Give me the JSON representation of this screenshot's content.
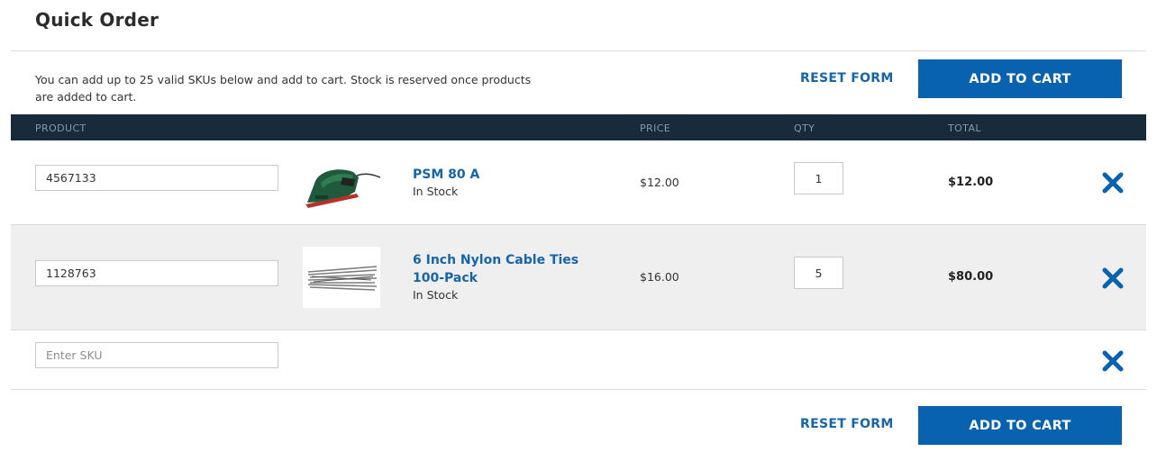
{
  "page": {
    "title": "Quick Order"
  },
  "intro": {
    "text": "You can add up to 25 valid SKUs below and add to cart. Stock is reserved once products are added to cart."
  },
  "actions": {
    "reset_label": "RESET FORM",
    "add_to_cart_label": "ADD TO CART"
  },
  "table": {
    "headers": {
      "product": "PRODUCT",
      "price": "PRICE",
      "qty": "QTY",
      "total": "TOTAL"
    },
    "rows": [
      {
        "sku": "4567133",
        "name": "PSM 80 A",
        "stock": "In Stock",
        "price": "$12.00",
        "qty": "1",
        "total": "$12.00",
        "image": "sander-icon"
      },
      {
        "sku": "1128763",
        "name": "6 Inch Nylon Cable Ties 100-Pack",
        "stock": "In Stock",
        "price": "$16.00",
        "qty": "5",
        "total": "$80.00",
        "image": "cable-ties-icon"
      }
    ],
    "empty_row": {
      "placeholder": "Enter SKU"
    }
  },
  "colors": {
    "accent": "#0862b0",
    "link": "#1565a8",
    "header_bg": "#182b3b",
    "alt_row_bg": "#efefef"
  },
  "icons": {
    "remove": "close-icon"
  }
}
